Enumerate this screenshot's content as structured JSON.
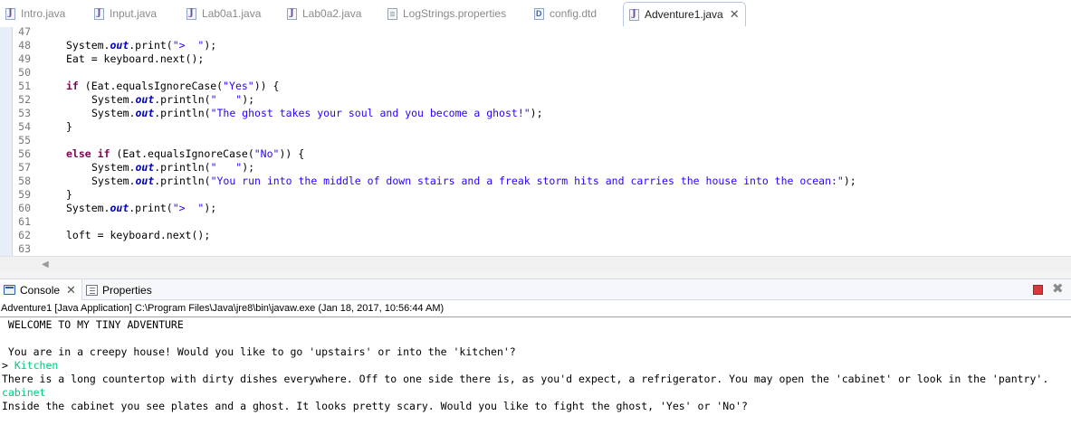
{
  "tabs": [
    {
      "label": "Intro.java",
      "icon": "java-file-icon"
    },
    {
      "label": "Input.java",
      "icon": "java-file-icon"
    },
    {
      "label": "Lab0a1.java",
      "icon": "java-file-icon"
    },
    {
      "label": "Lab0a2.java",
      "icon": "java-file-icon"
    },
    {
      "label": "LogStrings.properties",
      "icon": "properties-file-icon"
    },
    {
      "label": "config.dtd",
      "icon": "dtd-file-icon"
    },
    {
      "label": "Adventure1.java",
      "icon": "java-file-icon",
      "active": true,
      "close": "✕"
    }
  ],
  "editor": {
    "lines": [
      {
        "n": "47",
        "text": ""
      },
      {
        "n": "48",
        "text": "System.out.print(\">  \");"
      },
      {
        "n": "49",
        "text": "Eat = keyboard.next();"
      },
      {
        "n": "50",
        "text": ""
      },
      {
        "n": "51",
        "text": "if (Eat.equalsIgnoreCase(\"Yes\")) {"
      },
      {
        "n": "52",
        "text": "System.out.println(\"   \");"
      },
      {
        "n": "53",
        "text": "System.out.println(\"The ghost takes your soul and you become a ghost!\");"
      },
      {
        "n": "54",
        "text": "}"
      },
      {
        "n": "55",
        "text": ""
      },
      {
        "n": "56",
        "text": "else if (Eat.equalsIgnoreCase(\"No\")) {"
      },
      {
        "n": "57",
        "text": "System.out.println(\"   \");"
      },
      {
        "n": "58",
        "text": "System.out.println(\"You run into the middle of down stairs and a freak storm hits and carries the house into the ocean:\");"
      },
      {
        "n": "59",
        "text": "}"
      },
      {
        "n": "60",
        "text": "System.out.print(\">  \");"
      },
      {
        "n": "61",
        "text": ""
      },
      {
        "n": "62",
        "text": "loft = keyboard.next();"
      },
      {
        "n": "63",
        "text": ""
      }
    ]
  },
  "views": {
    "console_label": "Console",
    "console_close": "✕",
    "properties_label": "Properties"
  },
  "console": {
    "header": "Adventure1 [Java Application] C:\\Program Files\\Java\\jre8\\bin\\javaw.exe (Jan 18, 2017, 10:56:44 AM)",
    "lines": [
      {
        "text": " WELCOME TO MY TINY ADVENTURE",
        "input": false
      },
      {
        "text": "",
        "input": false
      },
      {
        "text": " You are in a creepy house! Would you like to go 'upstairs' or into the 'kitchen'?",
        "input": false
      },
      {
        "prompt": "> ",
        "text": "Kitchen",
        "input": true
      },
      {
        "text": "There is a long countertop with dirty dishes everywhere. Off to one side there is, as you'd expect, a refrigerator. You may open the 'cabinet' or look in the 'pantry'.",
        "input": false
      },
      {
        "text": "cabinet",
        "input": true
      },
      {
        "text": "Inside the cabinet you see plates and a ghost. It looks pretty scary. Would you like to fight the ghost, 'Yes' or 'No'?",
        "input": false
      }
    ]
  },
  "colors": {
    "keyword": "#7f0055",
    "field": "#0000c0",
    "string": "#2a00ff",
    "console_input": "#00c87d",
    "stop": "#d53b3b"
  }
}
